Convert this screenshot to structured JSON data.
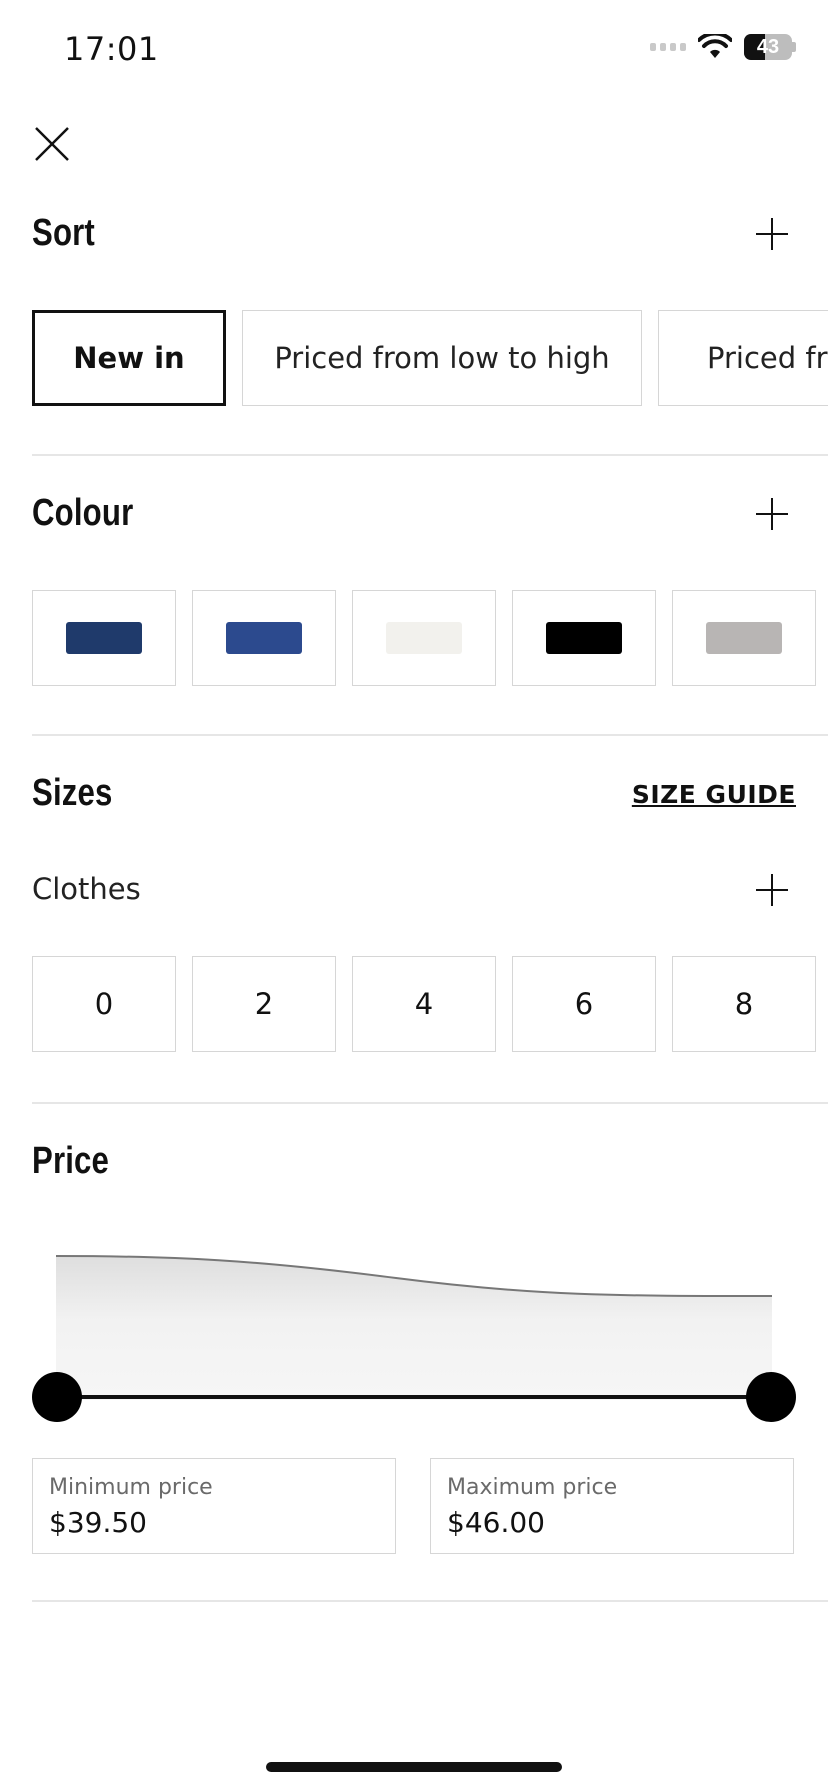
{
  "status_bar": {
    "time": "17:01",
    "battery": "43"
  },
  "sort": {
    "title": "Sort",
    "options": [
      "New in",
      "Priced from low to high",
      "Priced fro"
    ],
    "selected": 0
  },
  "colour": {
    "title": "Colour",
    "swatches": [
      "#1f3a6b",
      "#2c4a8e",
      "#f2f1ed",
      "#000000",
      "#b8b5b4"
    ]
  },
  "sizes": {
    "title": "Sizes",
    "size_guide": "SIZE GUIDE",
    "group_label": "Clothes",
    "values": [
      "0",
      "2",
      "4",
      "6",
      "8"
    ]
  },
  "price": {
    "title": "Price",
    "min_label": "Minimum price",
    "min_value": "$39.50",
    "max_label": "Maximum price",
    "max_value": "$46.00"
  }
}
